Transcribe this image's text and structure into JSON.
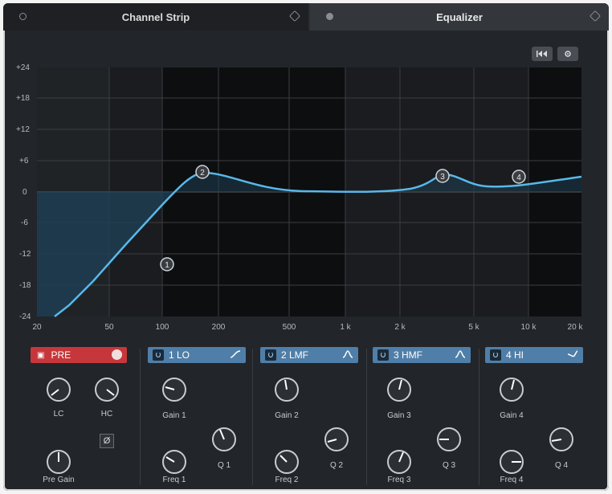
{
  "tabs": [
    {
      "label": "Channel Strip"
    },
    {
      "label": "Equalizer"
    }
  ],
  "header_buttons": {
    "reset_icon": "skip-back-icon",
    "settings_icon": "gear-icon"
  },
  "graph": {
    "y_ticks": [
      "+24",
      "+18",
      "+12",
      "+6",
      "0",
      "-6",
      "-12",
      "-18",
      "-24"
    ],
    "x_ticks": [
      "20",
      "50",
      "100",
      "200",
      "500",
      "1 k",
      "2 k",
      "5 k",
      "10 k",
      "20 k"
    ],
    "nodes": [
      "1",
      "2",
      "3",
      "4"
    ]
  },
  "pre": {
    "label": "PRE",
    "lc_label": "LC",
    "hc_label": "HC",
    "phase_symbol": "Ø",
    "pregain_label": "Pre Gain"
  },
  "bands": [
    {
      "name": "1 LO",
      "gain_label": "Gain 1",
      "freq_label": "Freq 1",
      "q_label": "Q 1",
      "shape": "low-shelf"
    },
    {
      "name": "2 LMF",
      "gain_label": "Gain 2",
      "freq_label": "Freq 2",
      "q_label": "Q 2",
      "shape": "peak"
    },
    {
      "name": "3 HMF",
      "gain_label": "Gain 3",
      "freq_label": "Freq 3",
      "q_label": "Q 3",
      "shape": "peak"
    },
    {
      "name": "4 HI",
      "gain_label": "Gain 4",
      "freq_label": "Freq 4",
      "q_label": "Q 4",
      "shape": "high-shelf"
    }
  ],
  "colors": {
    "band": "#4f7fa8",
    "pre": "#c6373b",
    "curve": "#58b8ea",
    "bg": "#222529"
  }
}
